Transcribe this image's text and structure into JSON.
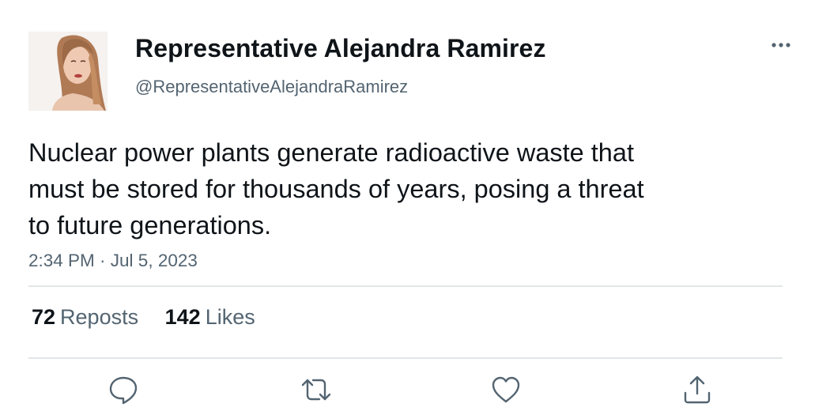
{
  "author": {
    "display_name": "Representative Alejandra Ramirez",
    "handle": "@RepresentativeAlejandraRamirez"
  },
  "tweet": {
    "lines": [
      "Nuclear power plants generate radioactive waste that",
      "must be stored for thousands of years, posing a threat",
      "to future generations."
    ],
    "timestamp": "2:34 PM · Jul 5, 2023"
  },
  "stats": {
    "reposts_count": "72",
    "reposts_label": "Reposts",
    "likes_count": "142",
    "likes_label": "Likes"
  },
  "actions": {
    "reply_icon": "reply-icon",
    "repost_icon": "repost-icon",
    "like_icon": "like-icon",
    "share_icon": "share-icon"
  },
  "colors": {
    "text_primary": "#0f1419",
    "text_secondary": "#536471",
    "divider": "#e3e6e8"
  }
}
